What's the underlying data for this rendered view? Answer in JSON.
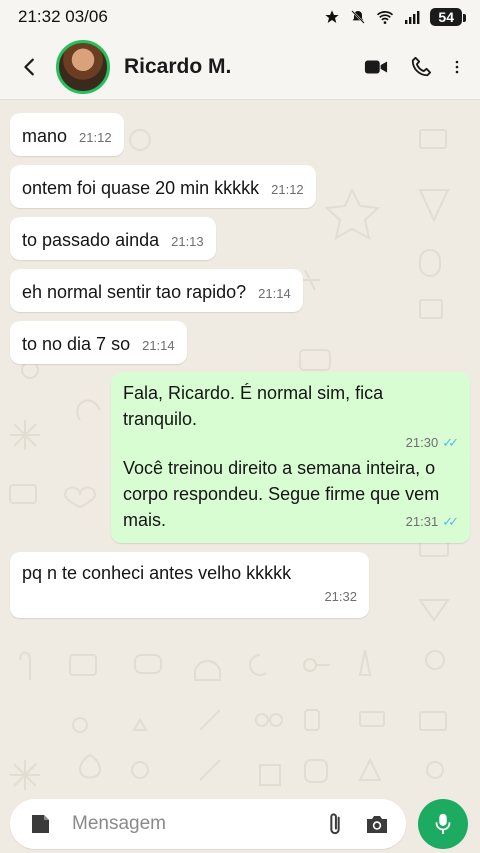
{
  "status": {
    "time_date": "21:32 03/06",
    "battery": "54"
  },
  "header": {
    "contact_name": "Ricardo M."
  },
  "messages": [
    {
      "text": "mano",
      "time": "21:12"
    },
    {
      "text": "ontem foi quase 20 min kkkkk",
      "time": "21:12"
    },
    {
      "text": "to passado ainda",
      "time": "21:13"
    },
    {
      "text": "eh normal sentir tao rapido?",
      "time": "21:14"
    },
    {
      "text": "to no dia 7 so",
      "time": "21:14"
    },
    {
      "text": "Fala, Ricardo. É normal sim, fica tranquilo.",
      "time": "21:30"
    },
    {
      "text": "Você treinou direito a semana inteira, o corpo respondeu. Segue firme que vem mais.",
      "time": "21:31"
    },
    {
      "text": "pq n te conheci antes velho kkkkk",
      "time": "21:32"
    }
  ],
  "composer": {
    "placeholder": "Mensagem"
  },
  "colors": {
    "incoming": "#ffffff",
    "outgoing": "#d9fdd3",
    "accent": "#1daa61",
    "read_ticks": "#53bdeb"
  }
}
